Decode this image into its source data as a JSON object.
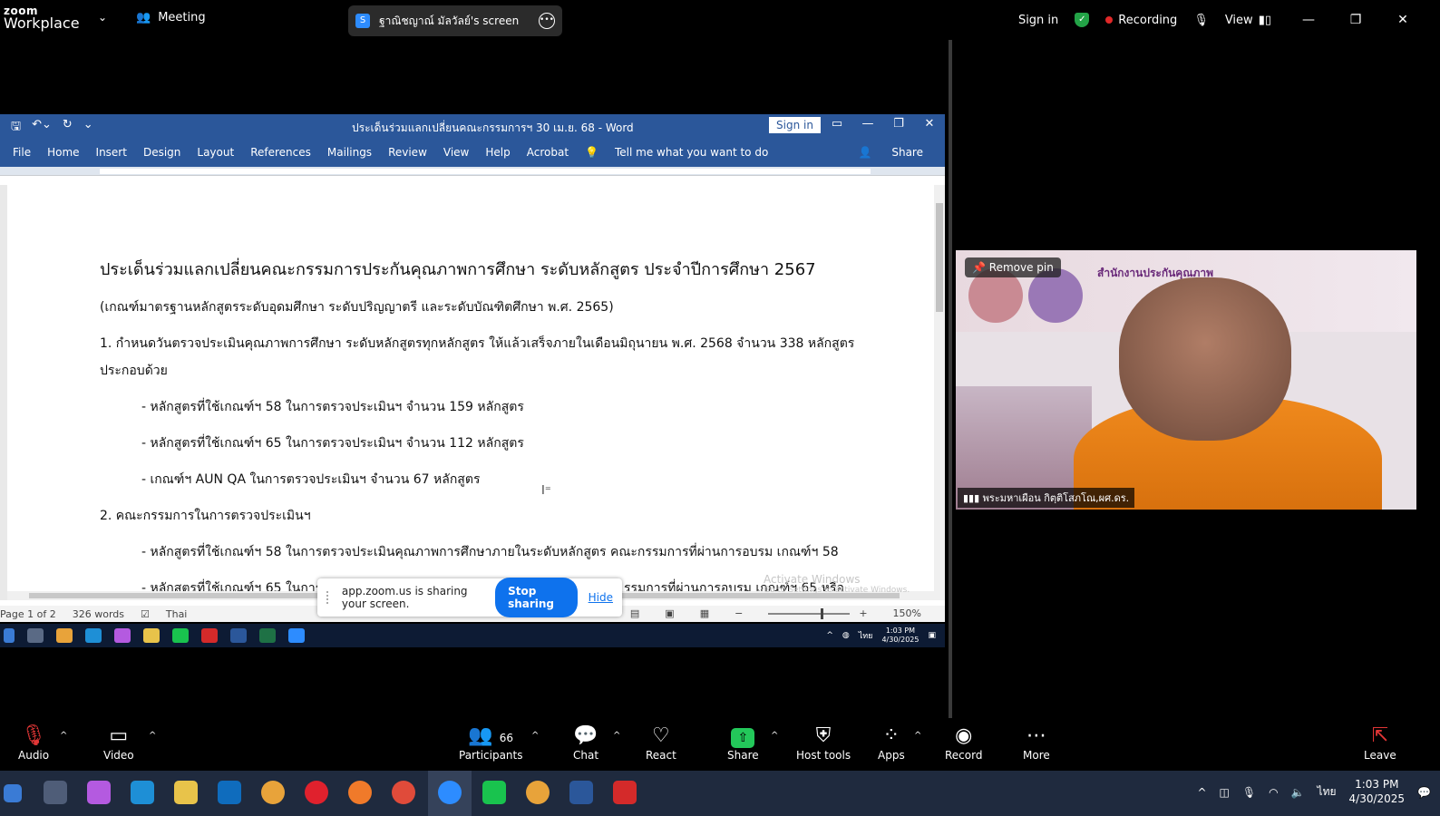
{
  "zoom_top": {
    "logo_line1": "zoom",
    "logo_line2": "Workplace",
    "meeting_label": "Meeting",
    "share_pill": "ฐาณิชญาณ์ มัลวัลย์'s screen",
    "sign_in": "Sign in",
    "recording": "Recording",
    "view": "View"
  },
  "word": {
    "doc_title": "ประเด็นร่วมแลกเปลี่ยนคณะกรรมการฯ 30 เม.ย. 68  -  Word",
    "sign_in": "Sign in",
    "menu": [
      "File",
      "Home",
      "Insert",
      "Design",
      "Layout",
      "References",
      "Mailings",
      "Review",
      "View",
      "Help",
      "Acrobat"
    ],
    "tell_me": "Tell me what you want to do",
    "share": "Share",
    "lines": [
      "ประเด็นร่วมแลกเปลี่ยนคณะกรรมการประกันคุณภาพการศึกษา ระดับหลักสูตร ประจำปีการศึกษา 2567",
      "(เกณฑ์มาตรฐานหลักสูตรระดับอุดมศึกษา  ระดับปริญญาตรี และระดับบัณฑิตศึกษา พ.ศ. 2565)",
      "1. กำหนดวันตรวจประเมินคุณภาพการศึกษา ระดับหลักสูตรทุกหลักสูตร ให้แล้วเสร็จภายในเดือนมิถุนายน พ.ศ. 2568 จำนวน 338 หลักสูตร",
      "ประกอบด้วย",
      "- หลักสูตรที่ใช้เกณฑ์ฯ 58 ในการตรวจประเมินฯ  จำนวน 159 หลักสูตร",
      "- หลักสูตรที่ใช้เกณฑ์ฯ 65 ในการตรวจประเมินฯ  จำนวน 112 หลักสูตร",
      "- เกณฑ์ฯ AUN QA ในการตรวจประเมินฯ          จำนวน 67 หลักสูตร",
      "2. คณะกรรมการในการตรวจประเมินฯ",
      "- หลักสูตรที่ใช้เกณฑ์ฯ 58 ในการตรวจประเมินคุณภาพการศึกษาภายในระดับหลักสูตร คณะกรรมการที่ผ่านการอบรม เกณฑ์ฯ 58",
      "- หลักสูตรที่ใช้เกณฑ์ฯ 65 ในการต"
    ],
    "line_tail": "รรมการที่ผ่านการอบรม เกณฑ์ฯ 65 หรือ",
    "status": {
      "page": "Page 1 of 2",
      "words": "326 words",
      "lang": "Thai",
      "zoom": "150%"
    }
  },
  "notice": {
    "text": "app.zoom.us is sharing your screen.",
    "stop": "Stop sharing",
    "hide": "Hide"
  },
  "watermark": {
    "line1": "Activate Windows",
    "line2": "Go to Settings to activate Windows."
  },
  "inner_taskbar": {
    "time": "1:03 PM",
    "date": "4/30/2025",
    "lang": "ไทย"
  },
  "video": {
    "pin_label": "Remove pin",
    "name": "พระมหาเผือน กิตฺติโสภโณ,ผศ.ดร.",
    "banner_text": "สำนักงานประกันคุณภาพ"
  },
  "toolbar": {
    "audio": "Audio",
    "video": "Video",
    "participants": "Participants",
    "participants_count": "66",
    "chat": "Chat",
    "react": "React",
    "share": "Share",
    "host_tools": "Host tools",
    "apps": "Apps",
    "record": "Record",
    "more": "More",
    "leave": "Leave"
  },
  "windows_taskbar": {
    "lang": "ไทย",
    "time": "1:03 PM",
    "date": "4/30/2025"
  }
}
